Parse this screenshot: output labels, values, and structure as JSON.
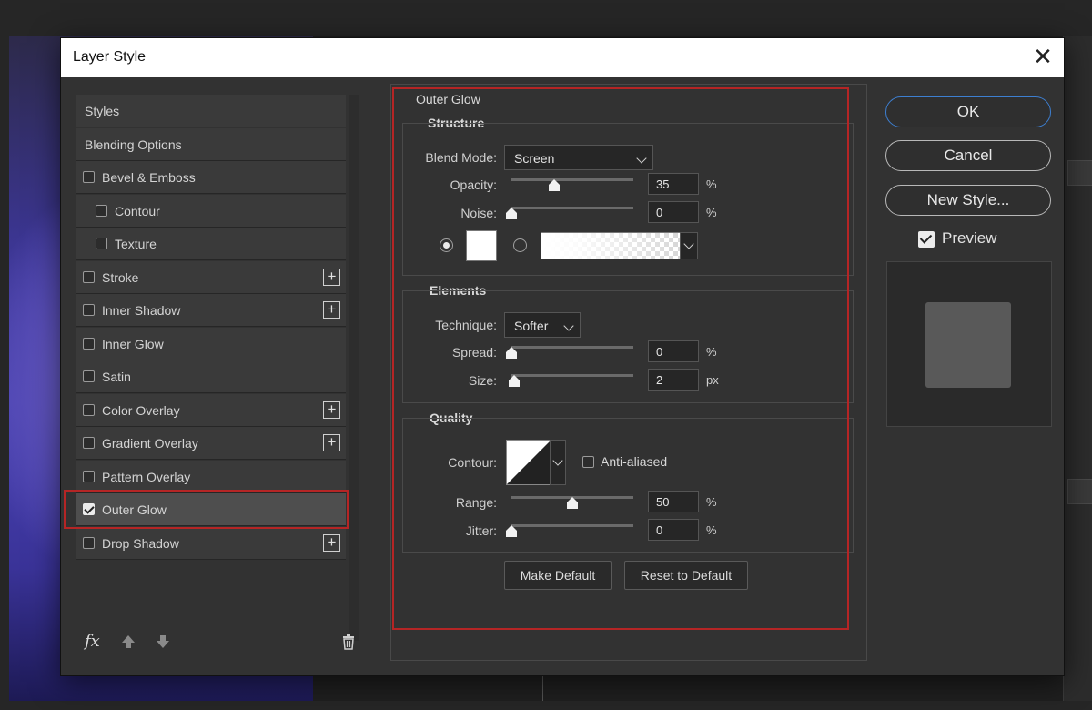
{
  "dialog": {
    "title": "Layer Style",
    "close": "✕"
  },
  "styles_list": {
    "items": [
      {
        "label": "Styles",
        "checkbox": false,
        "checked": false,
        "indent": false,
        "add": false
      },
      {
        "label": "Blending Options",
        "checkbox": false,
        "checked": false,
        "indent": false,
        "add": false
      },
      {
        "label": "Bevel & Emboss",
        "checkbox": true,
        "checked": false,
        "indent": false,
        "add": false
      },
      {
        "label": "Contour",
        "checkbox": true,
        "checked": false,
        "indent": true,
        "add": false
      },
      {
        "label": "Texture",
        "checkbox": true,
        "checked": false,
        "indent": true,
        "add": false
      },
      {
        "label": "Stroke",
        "checkbox": true,
        "checked": false,
        "indent": false,
        "add": true
      },
      {
        "label": "Inner Shadow",
        "checkbox": true,
        "checked": false,
        "indent": false,
        "add": true
      },
      {
        "label": "Inner Glow",
        "checkbox": true,
        "checked": false,
        "indent": false,
        "add": false
      },
      {
        "label": "Satin",
        "checkbox": true,
        "checked": false,
        "indent": false,
        "add": false
      },
      {
        "label": "Color Overlay",
        "checkbox": true,
        "checked": false,
        "indent": false,
        "add": true
      },
      {
        "label": "Gradient Overlay",
        "checkbox": true,
        "checked": false,
        "indent": false,
        "add": true
      },
      {
        "label": "Pattern Overlay",
        "checkbox": true,
        "checked": false,
        "indent": false,
        "add": false
      },
      {
        "label": "Outer Glow",
        "checkbox": true,
        "checked": true,
        "indent": false,
        "add": false,
        "active": true
      },
      {
        "label": "Drop Shadow",
        "checkbox": true,
        "checked": false,
        "indent": false,
        "add": true
      }
    ],
    "footer": {
      "fx": "fx",
      "icons": [
        "fx-icon",
        "move-up-icon",
        "move-down-icon",
        "trash-icon"
      ]
    }
  },
  "outer_glow": {
    "title": "Outer Glow",
    "structure": {
      "title": "Structure",
      "blend_mode_label": "Blend Mode:",
      "blend_mode": "Screen",
      "opacity_label": "Opacity:",
      "opacity": "35",
      "opacity_unit": "%",
      "opacity_level": 0.35,
      "noise_label": "Noise:",
      "noise": "0",
      "noise_unit": "%",
      "noise_level": 0,
      "color_mode": "solid",
      "glow_color": "#ffffff"
    },
    "elements": {
      "title": "Elements",
      "technique_label": "Technique:",
      "technique": "Softer",
      "spread_label": "Spread:",
      "spread": "0",
      "spread_unit": "%",
      "spread_level": 0,
      "size_label": "Size:",
      "size": "2",
      "size_unit": "px",
      "size_level": 0.02
    },
    "quality": {
      "title": "Quality",
      "contour_label": "Contour:",
      "anti_aliased_label": "Anti-aliased",
      "anti_aliased": false,
      "range_label": "Range:",
      "range": "50",
      "range_unit": "%",
      "range_level": 0.5,
      "jitter_label": "Jitter:",
      "jitter": "0",
      "jitter_unit": "%",
      "jitter_level": 0
    },
    "make_default": "Make Default",
    "reset_default": "Reset to Default"
  },
  "actions": {
    "ok": "OK",
    "cancel": "Cancel",
    "new_style": "New Style...",
    "preview_label": "Preview",
    "preview_checked": true
  },
  "colors": {
    "highlight_red": "#b52525",
    "ok_border": "#3d7fd1",
    "dialog_bg": "#323232"
  }
}
